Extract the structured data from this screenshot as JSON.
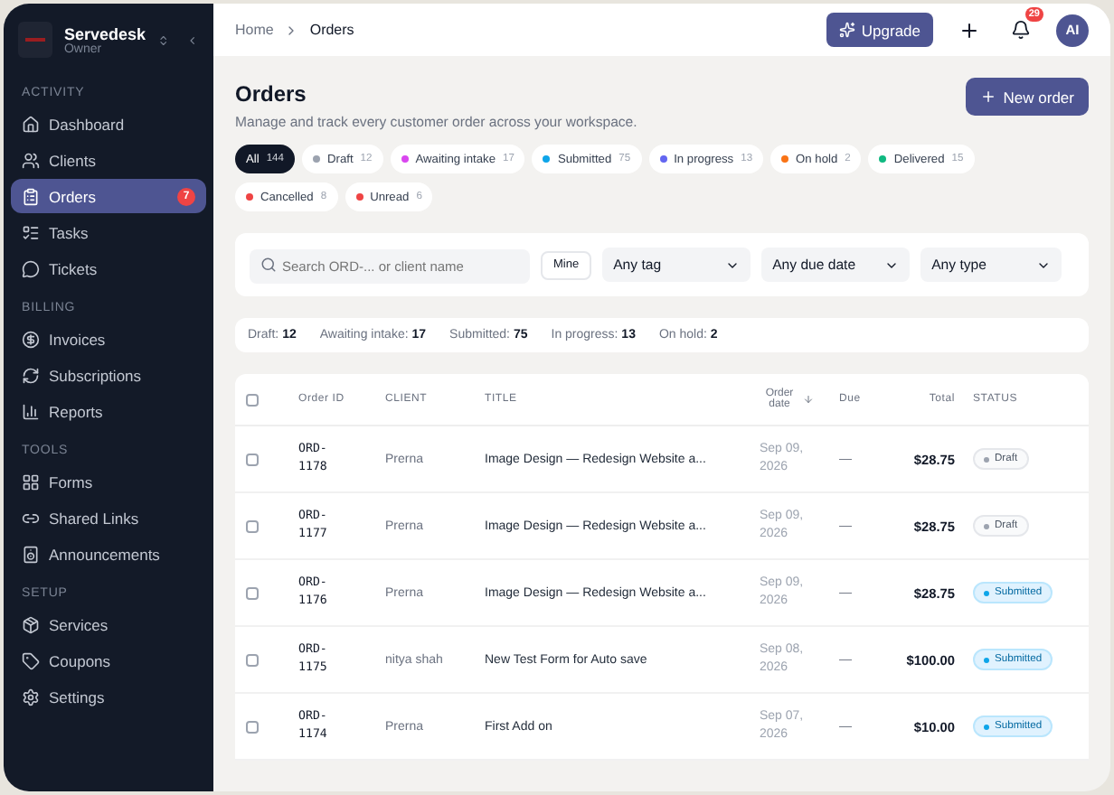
{
  "workspace": {
    "name": "Servedesk",
    "role": "Owner"
  },
  "sidebar": {
    "sections": [
      {
        "title": "ACTIVITY",
        "items": [
          {
            "label": "Dashboard",
            "selected": false
          },
          {
            "label": "Clients",
            "selected": false
          },
          {
            "label": "Orders",
            "selected": true,
            "badge": "7"
          },
          {
            "label": "Tasks",
            "selected": false
          },
          {
            "label": "Tickets",
            "selected": false
          }
        ]
      },
      {
        "title": "BILLING",
        "items": [
          {
            "label": "Invoices",
            "selected": false
          },
          {
            "label": "Subscriptions",
            "selected": false
          },
          {
            "label": "Reports",
            "selected": false
          }
        ]
      },
      {
        "title": "TOOLS",
        "items": [
          {
            "label": "Forms",
            "selected": false
          },
          {
            "label": "Shared Links",
            "selected": false
          },
          {
            "label": "Announcements",
            "selected": false
          }
        ]
      },
      {
        "title": "SETUP",
        "items": [
          {
            "label": "Services",
            "selected": false
          },
          {
            "label": "Coupons",
            "selected": false
          },
          {
            "label": "Settings",
            "selected": false
          }
        ]
      }
    ]
  },
  "breadcrumb": [
    "Home",
    "Orders"
  ],
  "header": {
    "upgrade": "Upgrade",
    "notifications": "29",
    "avatar": "AI"
  },
  "page": {
    "title": "Orders",
    "subtitle": "Manage and track every customer order across your workspace.",
    "new_button": "New order"
  },
  "chips": [
    {
      "label": "All",
      "count": "144",
      "selected": true
    },
    {
      "label": "Draft",
      "count": "12",
      "color": "#9ca3af",
      "selected": false
    },
    {
      "label": "Awaiting intake",
      "count": "17",
      "color": "#d946ef",
      "selected": false
    },
    {
      "label": "Submitted",
      "count": "75",
      "color": "#0ea5e9",
      "selected": false
    },
    {
      "label": "In progress",
      "count": "13",
      "color": "#6366f1",
      "selected": false
    },
    {
      "label": "On hold",
      "count": "2",
      "color": "#f97316",
      "selected": false
    },
    {
      "label": "Delivered",
      "count": "15",
      "color": "#10b981",
      "selected": false
    },
    {
      "label": "Cancelled",
      "count": "8",
      "color": "#ef4444",
      "selected": false
    },
    {
      "label": "Unread",
      "count": "6",
      "color": "#ef4444",
      "selected": false
    }
  ],
  "filters": {
    "search_placeholder": "Search ORD-... or client name",
    "mine": "Mine",
    "selects": [
      "Any tag",
      "Any due date",
      "Any type"
    ]
  },
  "summary": [
    {
      "label": "Draft:",
      "value": "12"
    },
    {
      "label": "Awaiting intake:",
      "value": "17"
    },
    {
      "label": "Submitted:",
      "value": "75"
    },
    {
      "label": "In progress:",
      "value": "13"
    },
    {
      "label": "On hold:",
      "value": "2"
    }
  ],
  "table": {
    "select_all_checked": false,
    "columns": [
      "Order ID",
      "CLIENT",
      "TITLE",
      "Order date",
      "Due",
      "Total",
      "STATUS"
    ],
    "rows": [
      {
        "id": "ORD-1178",
        "client": "Prerna",
        "title": "Image Design — Redesign Website a...",
        "date": "Sep 09, 2026",
        "due": "—",
        "total": "$28.75",
        "status": "Draft",
        "kind": "draft",
        "checked": false
      },
      {
        "id": "ORD-1177",
        "client": "Prerna",
        "title": "Image Design — Redesign Website a...",
        "date": "Sep 09, 2026",
        "due": "—",
        "total": "$28.75",
        "status": "Draft",
        "kind": "draft",
        "checked": false
      },
      {
        "id": "ORD-1176",
        "client": "Prerna",
        "title": "Image Design — Redesign Website a...",
        "date": "Sep 09, 2026",
        "due": "—",
        "total": "$28.75",
        "status": "Submitted",
        "kind": "submitted",
        "checked": false
      },
      {
        "id": "ORD-1175",
        "client": "nitya shah",
        "title": "New Test Form for Auto save",
        "date": "Sep 08, 2026",
        "due": "—",
        "total": "$100.00",
        "status": "Submitted",
        "kind": "submitted",
        "checked": false
      },
      {
        "id": "ORD-1174",
        "client": "Prerna",
        "title": "First Add on",
        "date": "Sep 07, 2026",
        "due": "—",
        "total": "$10.00",
        "status": "Submitted",
        "kind": "submitted",
        "checked": false
      }
    ]
  }
}
